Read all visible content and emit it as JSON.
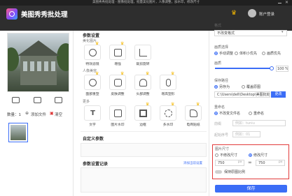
{
  "window": {
    "top_strip": "美图秀秀批处理 - 图像批处理，批量美化图片，人像调整，加水印，修改尺寸",
    "title": "美图秀秀批处理",
    "user_login": "账户登录"
  },
  "left": {
    "count_label": "数量：1",
    "add_file": "添加文件",
    "clear": "清空"
  },
  "middle": {
    "section_title": "参数设置",
    "beauty_label": "美化图片",
    "beauty_tools": [
      "特效滤镜",
      "增强",
      "裁剪旋转"
    ],
    "portrait_label": "人像美容",
    "portrait_tools": [
      "面部重塑",
      "皮肤调整",
      "头部调整",
      "增高塑形"
    ],
    "more_label": "更多",
    "more_tools": [
      "文字",
      "图片水印",
      "边框",
      "多水印",
      "电商贴纸"
    ],
    "custom_title": "自定义参数",
    "record_title": "参数设置记录",
    "record_link": "添加当前设置"
  },
  "right": {
    "format_label": "格式",
    "format_value": "不改变格式",
    "quality_label": "画质选择",
    "quality_options": [
      "手动调整",
      "体积小优先",
      "画质优先"
    ],
    "quality_label2": "画质",
    "quality_percent": "100 %",
    "quality_value": 1.0,
    "save_path_label": "保存路径",
    "save_as": "另存为",
    "overwrite": "覆盖原图",
    "path_value": "C:\\Users\\dell\\Desktop\\美图批处理",
    "browse": "更改",
    "rename_label": "重命名",
    "rename_options": [
      "不改变文件名",
      "重命名"
    ],
    "prefix_label": "前缀",
    "prefix_placeholder": "例如：tuniu",
    "start_label": "起始序号",
    "start_placeholder": "例如：01",
    "size_label": "图片尺寸",
    "size_options": [
      "不修改尺寸",
      "修改尺寸"
    ],
    "width": "750",
    "height": "750",
    "unit": "px",
    "keep_ratio": "保持原图比例",
    "save_button": "保存"
  },
  "colors": {
    "accent": "#3b6df6",
    "highlight": "#e23b3b",
    "crown": "#f5b800"
  }
}
